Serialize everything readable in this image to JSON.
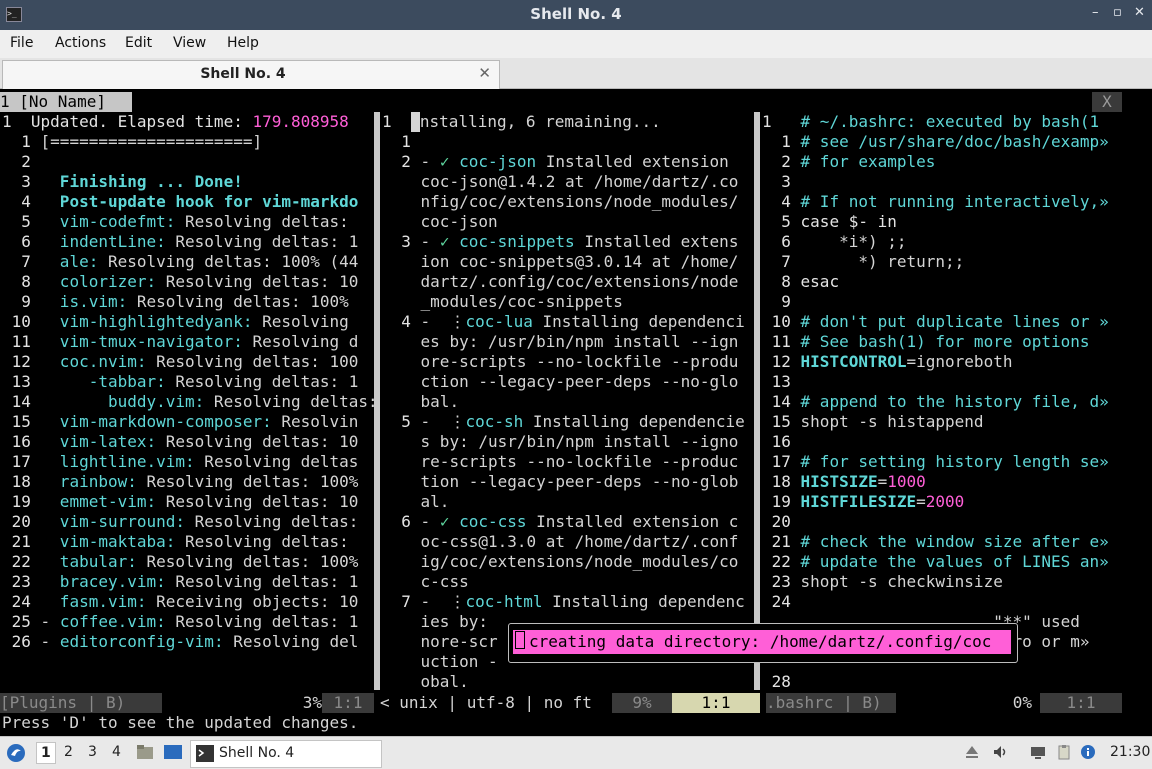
{
  "window": {
    "title": "Shell No. 4",
    "buttons": {
      "minimize": "–",
      "maximize": "□",
      "restore": "▫",
      "close": "✕"
    }
  },
  "menu": [
    "File",
    "Actions",
    "Edit",
    "View",
    "Help"
  ],
  "tab": {
    "label": "Shell No. 4",
    "close": "✕"
  },
  "vim": {
    "tabline": {
      "tab": "1 [No Name]",
      "close": "X"
    },
    "left": {
      "lines": [
        {
          "num": "1",
          "parts": [
            {
              "t": "  Updated. Elapsed time: ",
              "c": "c-head"
            },
            {
              "t": "179.808958",
              "c": "c-mag"
            }
          ]
        },
        {
          "num": "  1",
          "parts": [
            {
              "t": " [=====================]"
            }
          ]
        },
        {
          "num": "  2",
          "parts": []
        },
        {
          "num": "  3",
          "parts": [
            {
              "t": "   Finishing ... Done!",
              "c": "c-cyb"
            }
          ]
        },
        {
          "num": "  4",
          "parts": [
            {
              "t": "   Post-update hook for vim-markdo",
              "c": "c-cyb"
            }
          ]
        },
        {
          "num": "  5",
          "parts": [
            {
              "t": "   vim-codefmt:",
              "c": "c-cy"
            },
            {
              "t": " Resolving deltas:"
            }
          ]
        },
        {
          "num": "  6",
          "parts": [
            {
              "t": "   indentLine:",
              "c": "c-cy"
            },
            {
              "t": " Resolving deltas: 1"
            }
          ]
        },
        {
          "num": "  7",
          "parts": [
            {
              "t": "   ale:",
              "c": "c-cy"
            },
            {
              "t": " Resolving deltas: 100% (44"
            }
          ]
        },
        {
          "num": "  8",
          "parts": [
            {
              "t": "   colorizer:",
              "c": "c-cy"
            },
            {
              "t": " Resolving deltas: 10"
            }
          ]
        },
        {
          "num": "  9",
          "parts": [
            {
              "t": "   is.vim:",
              "c": "c-cy"
            },
            {
              "t": " Resolving deltas: 100%"
            }
          ]
        },
        {
          "num": " 10",
          "parts": [
            {
              "t": "   vim-highlightedyank:",
              "c": "c-cy"
            },
            {
              "t": " Resolving"
            }
          ]
        },
        {
          "num": " 11",
          "parts": [
            {
              "t": "   vim-tmux-navigator:",
              "c": "c-cy"
            },
            {
              "t": " Resolving d"
            }
          ]
        },
        {
          "num": " 12",
          "parts": [
            {
              "t": "   coc.nvim:",
              "c": "c-cy"
            },
            {
              "t": " Resolving deltas: 100"
            }
          ]
        },
        {
          "num": " 13",
          "parts": [
            {
              "t": "      -tabbar:",
              "c": "c-cy"
            },
            {
              "t": " Resolving deltas: 1"
            }
          ]
        },
        {
          "num": " 14",
          "parts": [
            {
              "t": "        buddy.vim:",
              "c": "c-cy"
            },
            {
              "t": " Resolving deltas:"
            }
          ]
        },
        {
          "num": " 15",
          "parts": [
            {
              "t": "   vim-markdown-composer:",
              "c": "c-cy"
            },
            {
              "t": " Resolvin"
            }
          ]
        },
        {
          "num": " 16",
          "parts": [
            {
              "t": "   vim-latex:",
              "c": "c-cy"
            },
            {
              "t": " Resolving deltas: 10"
            }
          ]
        },
        {
          "num": " 17",
          "parts": [
            {
              "t": "   lightline.vim:",
              "c": "c-cy"
            },
            {
              "t": " Resolving deltas"
            }
          ]
        },
        {
          "num": " 18",
          "parts": [
            {
              "t": "   rainbow:",
              "c": "c-cy"
            },
            {
              "t": " Resolving deltas: 100%"
            }
          ]
        },
        {
          "num": " 19",
          "parts": [
            {
              "t": "   emmet-vim:",
              "c": "c-cy"
            },
            {
              "t": " Resolving deltas: 10"
            }
          ]
        },
        {
          "num": " 20",
          "parts": [
            {
              "t": "   vim-surround:",
              "c": "c-cy"
            },
            {
              "t": " Resolving deltas:"
            }
          ]
        },
        {
          "num": " 21",
          "parts": [
            {
              "t": "   vim-maktaba:",
              "c": "c-cy"
            },
            {
              "t": " Resolving deltas:"
            }
          ]
        },
        {
          "num": " 22",
          "parts": [
            {
              "t": "   tabular:",
              "c": "c-cy"
            },
            {
              "t": " Resolving deltas: 100%"
            }
          ]
        },
        {
          "num": " 23",
          "parts": [
            {
              "t": "   bracey.vim:",
              "c": "c-cy"
            },
            {
              "t": " Resolving deltas: 1"
            }
          ]
        },
        {
          "num": " 24",
          "parts": [
            {
              "t": "   fasm.vim:",
              "c": "c-cy"
            },
            {
              "t": " Receiving objects: 10"
            }
          ]
        },
        {
          "num": " 25",
          "parts": [
            {
              "t": " - "
            },
            {
              "t": "coffee.vim:",
              "c": "c-cy"
            },
            {
              "t": " Resolving deltas: 1"
            }
          ]
        },
        {
          "num": " 26",
          "parts": [
            {
              "t": " - "
            },
            {
              "t": "editorconfig-vim:",
              "c": "c-cy"
            },
            {
              "t": " Resolving del"
            }
          ]
        }
      ]
    },
    "middle": {
      "lines": [
        {
          "num": "1",
          "parts": [
            {
              "t": "  "
            },
            {
              "t": "Installing, 6 remaining...",
              "cursor": true
            }
          ]
        },
        {
          "num": "  1",
          "parts": []
        },
        {
          "num": "  2",
          "parts": [
            {
              "t": " - "
            },
            {
              "t": "✓",
              "c": "c-ok"
            },
            {
              "t": " coc-json",
              "c": "c-cy"
            },
            {
              "t": " Installed extension"
            }
          ]
        },
        {
          "num": "   ",
          "parts": [
            {
              "t": " coc-json@1.4.2 at /home/dartz/.co"
            }
          ]
        },
        {
          "num": "   ",
          "parts": [
            {
              "t": " nfig/coc/extensions/node_modules/"
            }
          ]
        },
        {
          "num": "   ",
          "parts": [
            {
              "t": " coc-json"
            }
          ]
        },
        {
          "num": "  3",
          "parts": [
            {
              "t": " - "
            },
            {
              "t": "✓",
              "c": "c-ok"
            },
            {
              "t": " coc-snippets",
              "c": "c-cy"
            },
            {
              "t": " Installed extens"
            }
          ]
        },
        {
          "num": "   ",
          "parts": [
            {
              "t": " ion coc-snippets@3.0.14 at /home/"
            }
          ]
        },
        {
          "num": "   ",
          "parts": [
            {
              "t": " dartz/.config/coc/extensions/node"
            }
          ]
        },
        {
          "num": "   ",
          "parts": [
            {
              "t": " _modules/coc-snippets"
            }
          ]
        },
        {
          "num": "  4",
          "parts": [
            {
              "t": " -  ⋮"
            },
            {
              "t": "coc-lua",
              "c": "c-cy"
            },
            {
              "t": " Installing dependenci"
            }
          ]
        },
        {
          "num": "   ",
          "parts": [
            {
              "t": " es by: /usr/bin/npm install --ign"
            }
          ]
        },
        {
          "num": "   ",
          "parts": [
            {
              "t": " ore-scripts --no-lockfile --produ"
            }
          ]
        },
        {
          "num": "   ",
          "parts": [
            {
              "t": " ction --legacy-peer-deps --no-glo"
            }
          ]
        },
        {
          "num": "   ",
          "parts": [
            {
              "t": " bal."
            }
          ]
        },
        {
          "num": "  5",
          "parts": [
            {
              "t": " -  ⋮"
            },
            {
              "t": "coc-sh",
              "c": "c-cy"
            },
            {
              "t": " Installing dependencie"
            }
          ]
        },
        {
          "num": "   ",
          "parts": [
            {
              "t": " s by: /usr/bin/npm install --igno"
            }
          ]
        },
        {
          "num": "   ",
          "parts": [
            {
              "t": " re-scripts --no-lockfile --produc"
            }
          ]
        },
        {
          "num": "   ",
          "parts": [
            {
              "t": " tion --legacy-peer-deps --no-glob"
            }
          ]
        },
        {
          "num": "   ",
          "parts": [
            {
              "t": " al."
            }
          ]
        },
        {
          "num": "  6",
          "parts": [
            {
              "t": " - "
            },
            {
              "t": "✓",
              "c": "c-ok"
            },
            {
              "t": " coc-css",
              "c": "c-cy"
            },
            {
              "t": " Installed extension c"
            }
          ]
        },
        {
          "num": "   ",
          "parts": [
            {
              "t": " oc-css@1.3.0 at /home/dartz/.conf"
            }
          ]
        },
        {
          "num": "   ",
          "parts": [
            {
              "t": " ig/coc/extensions/node_modules/co"
            }
          ]
        },
        {
          "num": "   ",
          "parts": [
            {
              "t": " c-css"
            }
          ]
        },
        {
          "num": "  7",
          "parts": [
            {
              "t": " -  ⋮"
            },
            {
              "t": "coc-html",
              "c": "c-cy"
            },
            {
              "t": " Installing dependenc"
            }
          ]
        },
        {
          "num": "   ",
          "parts": [
            {
              "t": " ies by:"
            }
          ]
        },
        {
          "num": "   ",
          "parts": [
            {
              "t": " nore-scr"
            }
          ]
        },
        {
          "num": "   ",
          "parts": [
            {
              "t": " uction -"
            }
          ]
        },
        {
          "num": "   ",
          "parts": [
            {
              "t": " obal."
            }
          ]
        }
      ]
    },
    "right": {
      "lines": [
        {
          "num": "1",
          "parts": [
            {
              "t": "   # ~/.bashrc: executed by bash(1",
              "c": "c-cy"
            }
          ]
        },
        {
          "num": "  1",
          "parts": [
            {
              "t": " # see /usr/share/doc/bash/examp",
              "c": "c-cy"
            },
            {
              "t": "»",
              "c": "c-cy"
            }
          ]
        },
        {
          "num": "  2",
          "parts": [
            {
              "t": " # for examples",
              "c": "c-cy"
            }
          ]
        },
        {
          "num": "  3",
          "parts": []
        },
        {
          "num": "  4",
          "parts": [
            {
              "t": " # If not running interactively,",
              "c": "c-cy"
            },
            {
              "t": "»",
              "c": "c-cy"
            }
          ]
        },
        {
          "num": "  5",
          "parts": [
            {
              "t": " case $- in",
              "c": "c-head"
            }
          ]
        },
        {
          "num": "  6",
          "parts": [
            {
              "t": "     *i*) ;;"
            }
          ]
        },
        {
          "num": "  7",
          "parts": [
            {
              "t": "       *) return;;"
            }
          ]
        },
        {
          "num": "  8",
          "parts": [
            {
              "t": " esac",
              "c": "c-head"
            }
          ]
        },
        {
          "num": "  9",
          "parts": []
        },
        {
          "num": " 10",
          "parts": [
            {
              "t": " # don't put duplicate lines or ",
              "c": "c-cy"
            },
            {
              "t": "»",
              "c": "c-cy"
            }
          ]
        },
        {
          "num": " 11",
          "parts": [
            {
              "t": " # See bash(1) for more options",
              "c": "c-cy"
            }
          ]
        },
        {
          "num": " 12",
          "parts": [
            {
              "t": " HISTCONTROL",
              "c": "c-cyb"
            },
            {
              "t": "=ignoreboth"
            }
          ]
        },
        {
          "num": " 13",
          "parts": []
        },
        {
          "num": " 14",
          "parts": [
            {
              "t": " # append to the history file, d",
              "c": "c-cy"
            },
            {
              "t": "»",
              "c": "c-cy"
            }
          ]
        },
        {
          "num": " 15",
          "parts": [
            {
              "t": " shopt -s histappend"
            }
          ]
        },
        {
          "num": " 16",
          "parts": []
        },
        {
          "num": " 17",
          "parts": [
            {
              "t": " # for setting history length se",
              "c": "c-cy"
            },
            {
              "t": "»",
              "c": "c-cy"
            }
          ]
        },
        {
          "num": " 18",
          "parts": [
            {
              "t": " HISTSIZE",
              "c": "c-cyb"
            },
            {
              "t": "="
            },
            {
              "t": "1000",
              "c": "c-num"
            }
          ]
        },
        {
          "num": " 19",
          "parts": [
            {
              "t": " HISTFILESIZE",
              "c": "c-cyb"
            },
            {
              "t": "="
            },
            {
              "t": "2000",
              "c": "c-num"
            }
          ]
        },
        {
          "num": " 20",
          "parts": []
        },
        {
          "num": " 21",
          "parts": [
            {
              "t": " # check the window size after e",
              "c": "c-cy"
            },
            {
              "t": "»",
              "c": "c-cy"
            }
          ]
        },
        {
          "num": " 22",
          "parts": [
            {
              "t": " # update the values of LINES an",
              "c": "c-cy"
            },
            {
              "t": "»",
              "c": "c-cy"
            }
          ]
        },
        {
          "num": " 23",
          "parts": [
            {
              "t": " shopt -s checkwinsize"
            }
          ]
        },
        {
          "num": " 24",
          "parts": []
        },
        {
          "num": "   ",
          "parts": [
            {
              "t": "                     \"**\" used"
            }
          ]
        },
        {
          "num": "   ",
          "parts": [
            {
              "t": "                     zero or m"
            },
            {
              "t": "»"
            }
          ]
        },
        {
          "num": "   ",
          "parts": []
        },
        {
          "num": " 28",
          "parts": []
        }
      ]
    },
    "popup": {
      "message": "creating data directory: /home/dartz/.config/coc"
    },
    "status": {
      "left_name": "[Plugins | B)",
      "left_pct": "3%",
      "left_pos": "1:1",
      "middle_info": "< unix | utf-8 | no ft",
      "middle_pct": "9%",
      "middle_pos": "1:1",
      "right_name": ".bashrc | B)",
      "right_pct": "0%",
      "right_pos": "1:1"
    },
    "message_line": "Press 'D' to see the updated changes."
  },
  "taskbar": {
    "workspaces": [
      "1",
      "2",
      "3",
      "4"
    ],
    "app_label": "Shell No. 4",
    "clock": "21:30"
  },
  "colors": {
    "titlebar": "#3c4b5e",
    "cyan": "#5fd7d7",
    "magenta": "#ff5fd7",
    "statusline_dark": "#3a3a3a",
    "statusline_light": "#d7d7af"
  }
}
